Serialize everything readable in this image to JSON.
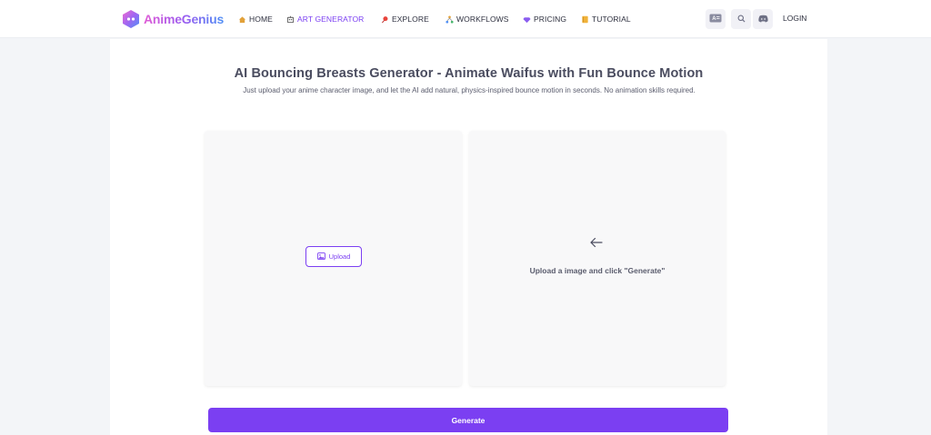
{
  "brand": {
    "name": "AnimeGenius"
  },
  "nav": {
    "items": [
      {
        "label": "HOME",
        "icon": "home-icon"
      },
      {
        "label": "ART GENERATOR",
        "icon": "robot-icon",
        "active": true
      },
      {
        "label": "EXPLORE",
        "icon": "pin-icon"
      },
      {
        "label": "WORKFLOWS",
        "icon": "workflow-icon"
      },
      {
        "label": "PRICING",
        "icon": "diamond-icon"
      },
      {
        "label": "TUTORIAL",
        "icon": "book-icon"
      }
    ],
    "login_label": "LOGIN"
  },
  "page": {
    "title": "AI Bouncing Breasts Generator - Animate Waifus with Fun Bounce Motion",
    "subtitle": "Just upload your anime character image, and let the AI add natural, physics-inspired bounce motion in seconds. No animation skills required."
  },
  "upload": {
    "label": "Upload"
  },
  "result": {
    "message": "Upload a image and click \"Generate\""
  },
  "actions": {
    "generate_label": "Generate"
  },
  "colors": {
    "accent": "#7b3ff2",
    "background": "#f3f5f8"
  }
}
